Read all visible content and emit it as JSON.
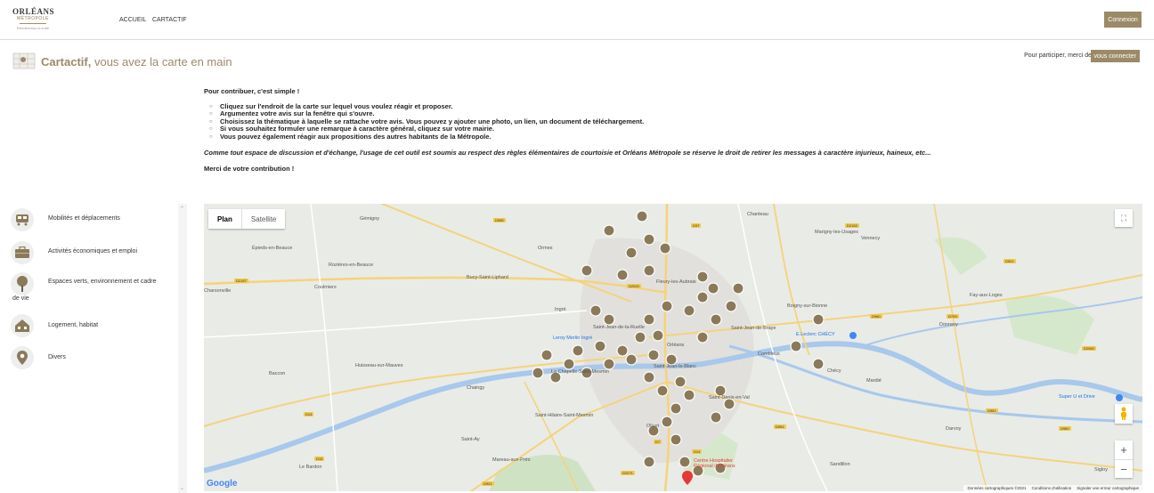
{
  "header": {
    "logo_line1": "ORLÉANS",
    "logo_line2": "MÉTROPOLE",
    "logo_tagline": "Rendezvous la suite",
    "nav": [
      "ACCUEIL",
      "CARTACTIF"
    ],
    "connexion_label": "Connexion"
  },
  "titlebar": {
    "title_strong": "Cartactif,",
    "title_rest": " vous avez la carte en main",
    "participate_text": "Pour participer, merci de",
    "connect_label": "vous connecter"
  },
  "intro": {
    "heading": "Pour contribuer, c'est simple !",
    "steps": [
      "Cliquez sur l'endroit de la carte sur lequel vous voulez réagir et proposer.",
      "Argumentez votre avis sur la fenêtre qui s'ouvre.",
      "Choisissez la thématique à laquelle se rattache votre avis. Vous pouvez y ajouter une photo, un lien, un document de téléchargement.",
      "Si vous souhaitez formuler une remarque à caractère général, cliquez sur votre mairie.",
      "Vous pouvez également réagir aux propositions des autres habitants de la Métropole."
    ],
    "warning": "Comme tout espace de discussion et d'échange, l'usage de cet outil est soumis au respect des règles élémentaires de courtoisie et Orléans Métropole se réserve le droit de retirer les messages à caractère injurieux, haineux, etc...",
    "thanks": "Merci de votre contribution !"
  },
  "categories": [
    {
      "label": "Mobilités et déplacements",
      "icon": "bus-icon"
    },
    {
      "label": "Activités économiques et emploi",
      "icon": "briefcase-icon"
    },
    {
      "label": "Espaces verts, environnement et cadre",
      "label2": "de vie",
      "icon": "tree-icon"
    },
    {
      "label": "Logement, habitat",
      "icon": "house-icon"
    },
    {
      "label": "Divers",
      "icon": "map-pin-icon"
    }
  ],
  "map": {
    "toggle": {
      "plan": "Plan",
      "satellite": "Satellite"
    },
    "google_logo": "Google",
    "attribution": [
      "Données cartographiques ©2021",
      "Conditions d'utilisation",
      "Signaler une erreur cartographique"
    ],
    "zoom_in": "+",
    "zoom_out": "−",
    "places": [
      "Gémigny",
      "Chanteau",
      "Marigny-les-Usages",
      "Vennecy",
      "Épieds-en-Beauce",
      "Rozières-en-Beauce",
      "Bucy-Saint-Liphard",
      "Ormes",
      "Coulmiers",
      "Charsonville",
      "Fleury-les-Aubrais",
      "Boigny-sur-Bionne",
      "Fay-aux-Loges",
      "Donnery",
      "Saint-Jean-de-Braye",
      "Ingré",
      "Orléans",
      "Combleux",
      "Huisseau-sur-Mauves",
      "Saint-Jean-le-Blanc",
      "Chécy",
      "Mardié",
      "Baccon",
      "Chaingy",
      "Saint-Denis-en-Val",
      "Saint-Hilaire-Saint-Mesmin",
      "Olivet",
      "Saint-Ay",
      "Mareau-aux-Prés",
      "Darvoy",
      "Sandillon",
      "Sigloy",
      "Le Bardon",
      "La Chapelle-Saint-Mesmin",
      "Saint-Jean-de-la-Ruelle"
    ],
    "poi": [
      "E.Leclerc CHÉCY",
      "Super U et Drive",
      "Centre Hospitalier Régional d'Orléans",
      "Leroy Merlin Ingré"
    ],
    "roads": [
      "D955",
      "D2157",
      "D2020",
      "D97",
      "D2152",
      "D921",
      "D709",
      "D960",
      "D13",
      "D951",
      "D960",
      "D2060",
      "D7",
      "D14",
      "D951",
      "D15",
      "D2271",
      "D921"
    ]
  }
}
